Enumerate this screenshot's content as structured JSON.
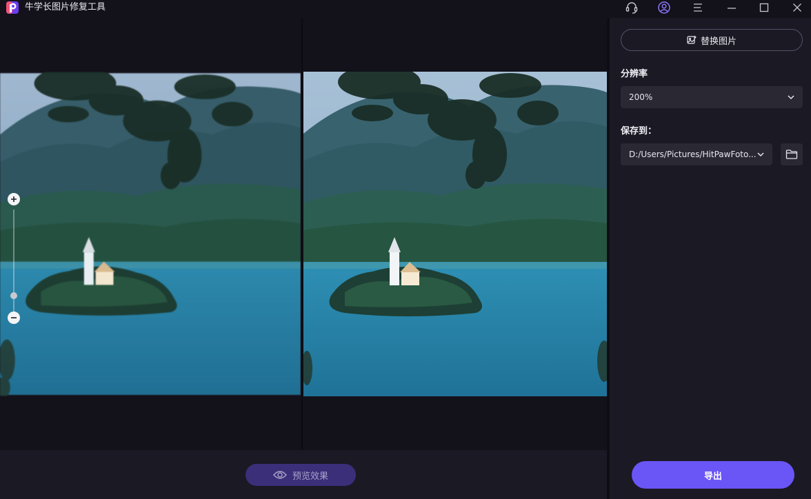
{
  "app": {
    "title": "牛学长图片修复工具",
    "logo_icon": "app-logo-icon"
  },
  "titlebar_icons": [
    "headset-icon",
    "user-account-icon",
    "menu-icon",
    "minimize-icon",
    "maximize-icon",
    "close-icon"
  ],
  "canvas": {
    "zoom_in_icon": "plus-icon",
    "zoom_out_icon": "minus-icon"
  },
  "footer": {
    "preview_label": "预览效果",
    "preview_icon": "eye-icon"
  },
  "panel": {
    "replace_label": "替换图片",
    "replace_icon": "image-replace-icon",
    "resolution_label": "分辨率",
    "resolution_value": "200%",
    "save_label": "保存到：",
    "save_path": "D:/Users/Pictures/HitPawFoto...",
    "folder_icon": "folder-icon",
    "export_label": "导出"
  },
  "colors": {
    "accent": "#6a55f6",
    "preview_button": "#3b2f7a",
    "background": "#131119",
    "panel": "#1b1923"
  }
}
